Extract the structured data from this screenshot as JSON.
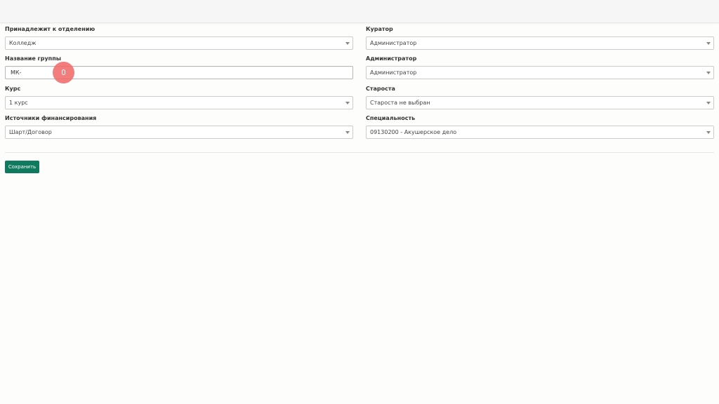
{
  "form": {
    "department": {
      "label": "Принадлежит к отделению",
      "value": "Колледж"
    },
    "curator": {
      "label": "Куратор",
      "value": "Администратор"
    },
    "group_name": {
      "label": "Название группы",
      "value": "МК-"
    },
    "administrator": {
      "label": "Администратор",
      "value": "Администратор"
    },
    "course": {
      "label": "Курс",
      "value": "1 курс"
    },
    "headman": {
      "label": "Староста",
      "value": "Староста не выбран"
    },
    "funding": {
      "label": "Источники финансирования",
      "value": "Шарт/Договор"
    },
    "specialty": {
      "label": "Специальность",
      "value": "09130200 - Акушерское дело"
    }
  },
  "actions": {
    "save_label": "Сохранить"
  },
  "colors": {
    "primary_button": "#0f7a5e",
    "cursor_highlight": "#f16666"
  }
}
